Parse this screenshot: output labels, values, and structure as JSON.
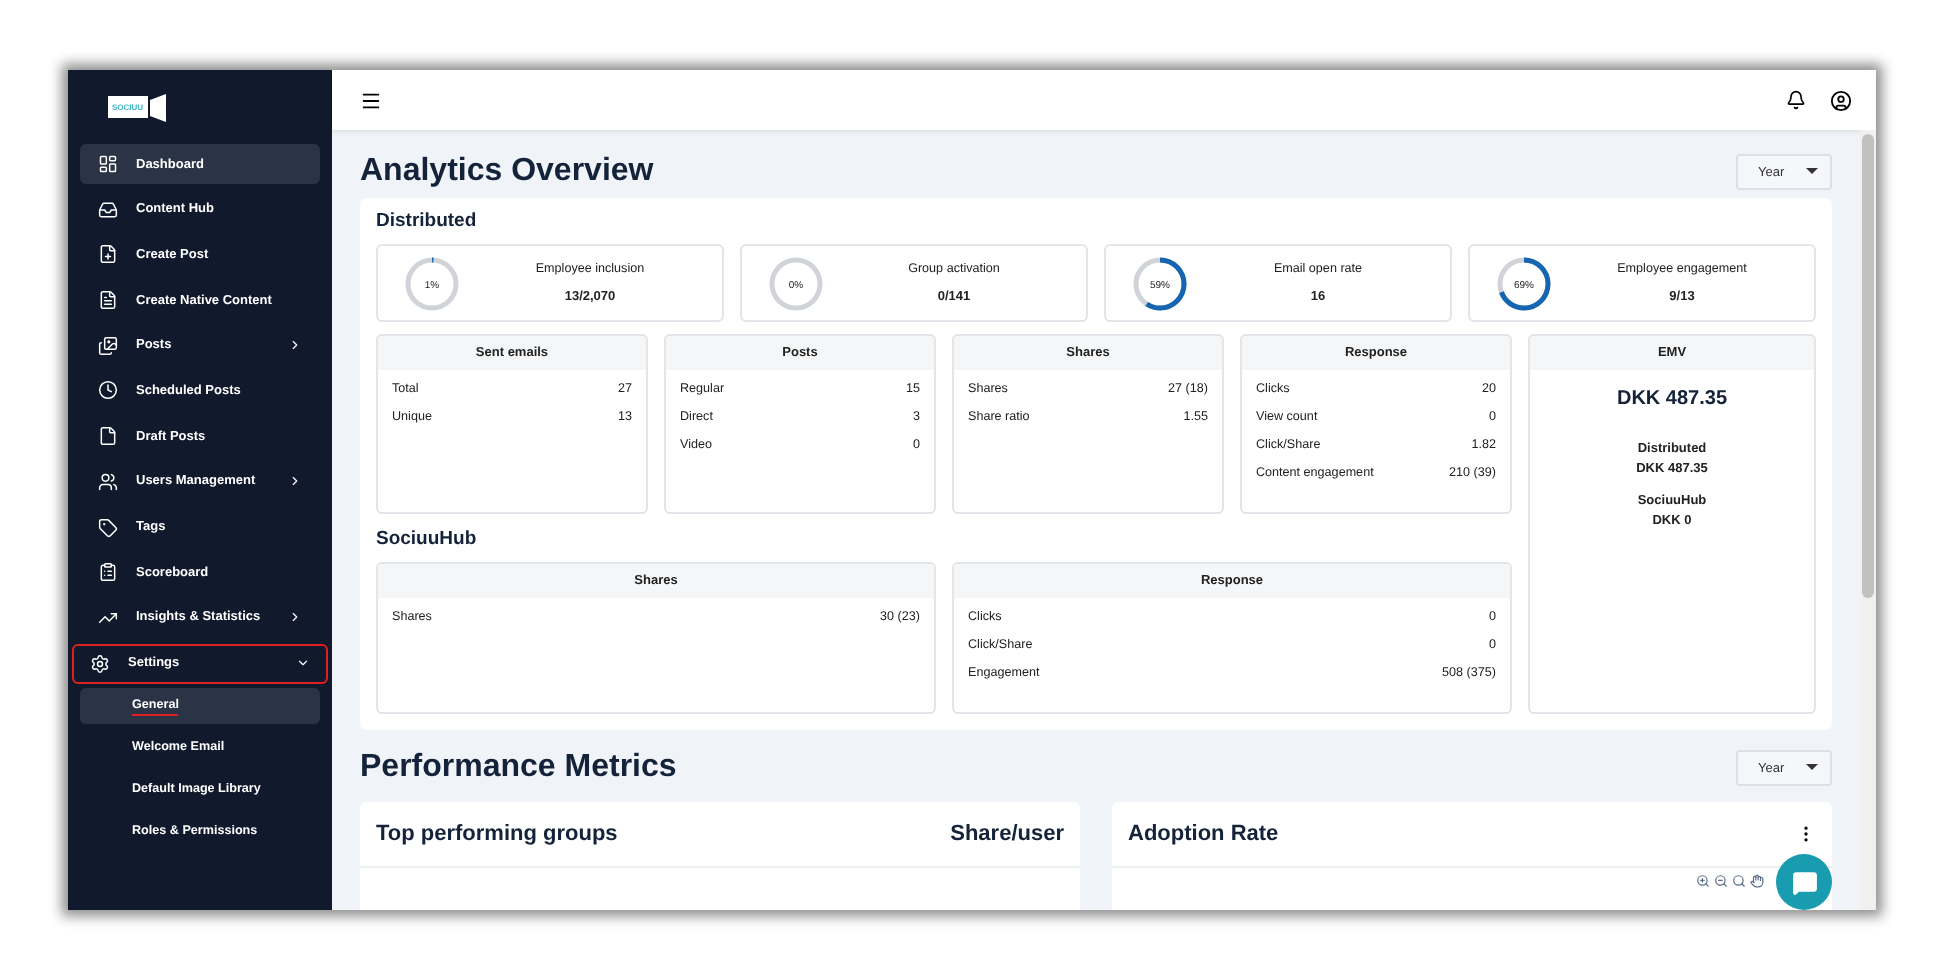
{
  "sidebar": {
    "logo_text": "SOCIUU",
    "items": [
      {
        "label": "Dashboard",
        "selected": true,
        "has_submenu": false
      },
      {
        "label": "Content Hub",
        "selected": false,
        "has_submenu": false
      },
      {
        "label": "Create Post",
        "selected": false,
        "has_submenu": false
      },
      {
        "label": "Create Native Content",
        "selected": false,
        "has_submenu": false
      },
      {
        "label": "Posts",
        "selected": false,
        "has_submenu": true,
        "expanded": false
      },
      {
        "label": "Scheduled Posts",
        "selected": false,
        "has_submenu": false
      },
      {
        "label": "Draft Posts",
        "selected": false,
        "has_submenu": false
      },
      {
        "label": "Users Management",
        "selected": false,
        "has_submenu": true,
        "expanded": false
      },
      {
        "label": "Tags",
        "selected": false,
        "has_submenu": false
      },
      {
        "label": "Scoreboard",
        "selected": false,
        "has_submenu": false
      },
      {
        "label": "Insights & Statistics",
        "selected": false,
        "has_submenu": true,
        "expanded": false
      },
      {
        "label": "Settings",
        "selected": false,
        "has_submenu": true,
        "expanded": true,
        "highlighted": true,
        "children": [
          {
            "label": "General",
            "selected": true,
            "underlined": true
          },
          {
            "label": "Welcome Email",
            "selected": false,
            "underlined": false
          },
          {
            "label": "Default Image Library",
            "selected": false,
            "underlined": false
          },
          {
            "label": "Roles & Permissions",
            "selected": false,
            "underlined": false
          }
        ]
      }
    ]
  },
  "analytics": {
    "title": "Analytics Overview",
    "period": "Year",
    "distributed_title": "Distributed",
    "gauges": [
      {
        "label": "Employee inclusion",
        "reading": "1%",
        "value": "13/2,070",
        "level": 0.01
      },
      {
        "label": "Group activation",
        "reading": "0%",
        "value": "0/141"
      },
      {
        "label": "Email open rate",
        "reading": "59%",
        "value": "16",
        "level": 0.59
      },
      {
        "label": "Employee engagement",
        "reading": "69%",
        "value": "9/13",
        "level": 0.69
      }
    ],
    "distributed_cards": [
      {
        "title": "Sent emails",
        "rows": [
          {
            "label": "Total",
            "value": "27"
          },
          {
            "label": "Unique",
            "value": "13"
          }
        ]
      },
      {
        "title": "Posts",
        "rows": [
          {
            "label": "Regular",
            "value": "15"
          },
          {
            "label": "Direct",
            "value": "3"
          },
          {
            "label": "Video",
            "value": "0"
          }
        ]
      },
      {
        "title": "Shares",
        "rows": [
          {
            "label": "Shares",
            "value": "27 (18)"
          },
          {
            "label": "Share ratio",
            "value": "1.55"
          }
        ]
      },
      {
        "title": "Response",
        "rows": [
          {
            "label": "Clicks",
            "value": "20"
          },
          {
            "label": "View count",
            "value": "0"
          },
          {
            "label": "Click/Share",
            "value": "1.82"
          },
          {
            "label": "Content engagement",
            "value": "210 (39)"
          }
        ]
      }
    ],
    "hub_title": "SociuuHub",
    "hub_cards": [
      {
        "title": "Shares",
        "rows": [
          {
            "label": "Shares",
            "value": "30 (23)"
          }
        ]
      },
      {
        "title": "Response",
        "rows": [
          {
            "label": "Clicks",
            "value": "0"
          },
          {
            "label": "Click/Share",
            "value": "0"
          },
          {
            "label": "Engagement",
            "value": "508 (375)"
          }
        ]
      }
    ],
    "emv": {
      "title": "EMV",
      "total": "DKK 487.35",
      "items": [
        {
          "label": "Distributed",
          "value": "DKK 487.35"
        },
        {
          "label": "SociuuHub",
          "value": "DKK 0"
        }
      ]
    }
  },
  "performance": {
    "title": "Performance Metrics",
    "period": "Year",
    "cards": [
      {
        "title": "Top performing groups",
        "side_label": "Share/user",
        "kind": "table"
      },
      {
        "title": "Adoption Rate",
        "kind": "chart"
      }
    ]
  }
}
